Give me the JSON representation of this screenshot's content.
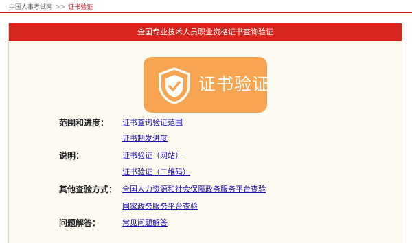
{
  "breadcrumb": {
    "home": "中国人事考试网",
    "separator": ">>",
    "current": "证书验证"
  },
  "panel": {
    "title": "全国专业技术人员职业资格证书查询验证"
  },
  "badge": {
    "text": "证书验证",
    "icon": "shield-check-icon",
    "color": "#f7a451"
  },
  "sections": {
    "scope": {
      "label": "范围和进度：",
      "links": [
        "证书查询验证范围",
        "证书制发进度"
      ]
    },
    "notes": {
      "label": "说明：",
      "links": [
        "证书验证（网站）",
        "证书验证（二维码）"
      ]
    },
    "other": {
      "label": "其他查验方式：",
      "links": [
        "全国人力资源和社会保障政务服务平台查验",
        "国家政务服务平台查验"
      ]
    },
    "faq": {
      "label": "问题解答：",
      "links": [
        "常见问题解答"
      ]
    }
  },
  "colors": {
    "accent_red": "#d9261c",
    "link_blue": "#1a0dab",
    "panel_bg": "#fdfaf2"
  }
}
